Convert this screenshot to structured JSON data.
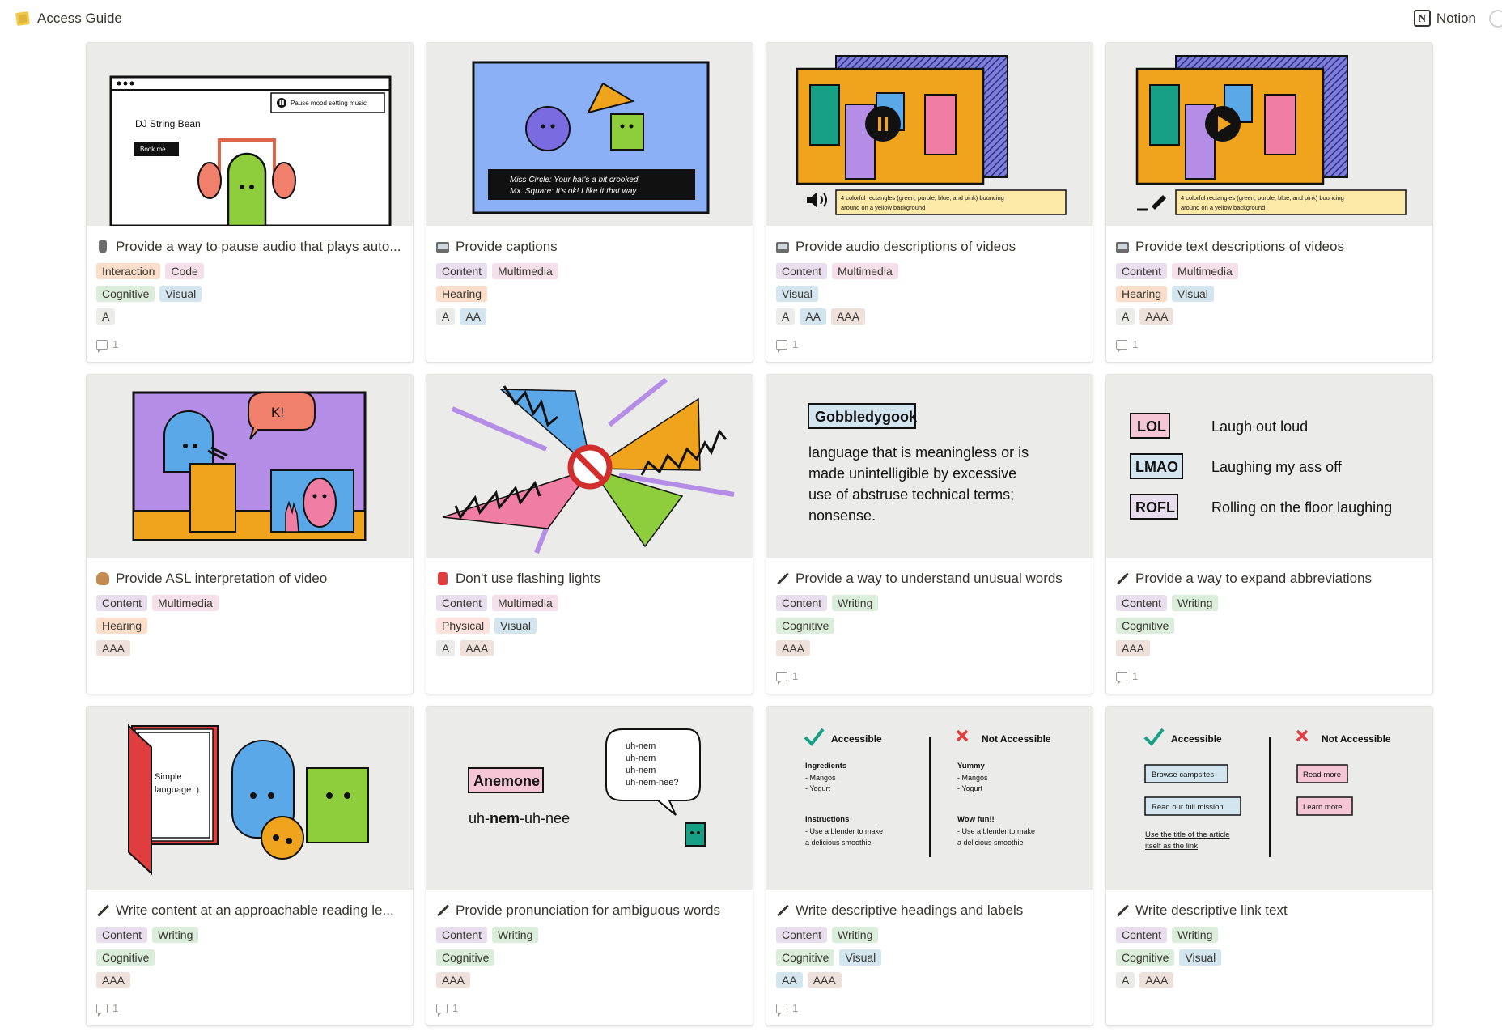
{
  "header": {
    "title": "Access Guide",
    "notion_label": "Notion"
  },
  "cards": [
    {
      "title": "Provide a way to pause audio that plays auto...",
      "icon": "microphone-icon",
      "tags": [
        [
          "Interaction",
          "Code"
        ],
        [
          "Cognitive",
          "Visual"
        ],
        [
          "A"
        ]
      ],
      "comments": "1",
      "illustration": {
        "pause_label": "Pause mood setting music",
        "site_name": "DJ String Bean",
        "book_button": "Book me"
      }
    },
    {
      "title": "Provide captions",
      "icon": "tv-icon",
      "tags": [
        [
          "Content",
          "Multimedia"
        ],
        [
          "Hearing"
        ],
        [
          "A",
          "AA"
        ]
      ],
      "comments": "",
      "illustration": {
        "caption_line1": "Miss Circle: Your hat's a bit crooked.",
        "caption_line2": "Mx. Square: It's ok! I like it that way."
      }
    },
    {
      "title": "Provide audio descriptions of videos",
      "icon": "tv-icon",
      "tags": [
        [
          "Content",
          "Multimedia"
        ],
        [
          "Visual"
        ],
        [
          "A",
          "AA",
          "AAA"
        ]
      ],
      "comments": "1",
      "illustration": {
        "desc_line1": "4 colorful rectangles (green, purple, blue, and pink) bouncing",
        "desc_line2": "around on a yellow background"
      }
    },
    {
      "title": "Provide text descriptions of videos",
      "icon": "tv-icon",
      "tags": [
        [
          "Content",
          "Multimedia"
        ],
        [
          "Hearing",
          "Visual"
        ],
        [
          "A",
          "AAA"
        ]
      ],
      "comments": "1",
      "illustration": {
        "desc_line1": "4 colorful rectangles (green, purple, blue, and pink) bouncing",
        "desc_line2": "around on a yellow background"
      }
    },
    {
      "title": "Provide ASL interpretation of video",
      "icon": "hand-icon",
      "tags": [
        [
          "Content",
          "Multimedia"
        ],
        [
          "Hearing"
        ],
        [
          "AAA"
        ]
      ],
      "comments": "",
      "illustration": {
        "speech": "K!"
      }
    },
    {
      "title": "Don't use flashing lights",
      "icon": "alarm-icon",
      "tags": [
        [
          "Content",
          "Multimedia"
        ],
        [
          "Physical",
          "Visual"
        ],
        [
          "A",
          "AAA"
        ]
      ],
      "comments": "",
      "illustration": {}
    },
    {
      "title": "Provide a way to understand unusual words",
      "icon": "pencil-icon",
      "tags": [
        [
          "Content",
          "Writing"
        ],
        [
          "Cognitive"
        ],
        [
          "AAA"
        ]
      ],
      "comments": "1",
      "illustration": {
        "word": "Gobbledygook",
        "def1": "language that is meaningless or is",
        "def2": "made unintelligible by excessive",
        "def3": "use of abstruse technical terms;",
        "def4": "nonsense."
      }
    },
    {
      "title": "Provide a way to expand abbreviations",
      "icon": "pencil-icon",
      "tags": [
        [
          "Content",
          "Writing"
        ],
        [
          "Cognitive"
        ],
        [
          "AAA"
        ]
      ],
      "comments": "1",
      "illustration": {
        "abbr": [
          [
            "LOL",
            "Laugh out loud"
          ],
          [
            "LMAO",
            "Laughing my ass off"
          ],
          [
            "ROFL",
            "Rolling on the floor laughing"
          ]
        ]
      }
    },
    {
      "title": "Write content at an approachable reading le...",
      "icon": "pencil-icon",
      "tags": [
        [
          "Content",
          "Writing"
        ],
        [
          "Cognitive"
        ],
        [
          "AAA"
        ]
      ],
      "comments": "1",
      "illustration": {
        "book1": "Simple",
        "book2": "language :)"
      }
    },
    {
      "title": "Provide pronunciation for ambiguous words",
      "icon": "pencil-icon",
      "tags": [
        [
          "Content",
          "Writing"
        ],
        [
          "Cognitive"
        ],
        [
          "AAA"
        ]
      ],
      "comments": "1",
      "illustration": {
        "word": "Anemone",
        "pron_prefix": "uh-",
        "pron_bold": "nem",
        "pron_suffix": "-uh-nee",
        "bubble": [
          "uh-nem",
          "uh-nem",
          "uh-nem",
          "uh-nem-nee?"
        ]
      }
    },
    {
      "title": "Write descriptive headings and labels",
      "icon": "pencil-icon",
      "tags": [
        [
          "Content",
          "Writing"
        ],
        [
          "Cognitive",
          "Visual"
        ],
        [
          "AA",
          "AAA"
        ]
      ],
      "comments": "1",
      "illustration": {
        "good": "Accessible",
        "bad": "Not Accessible",
        "h1": "Ingredients",
        "h1a": "- Mangos",
        "h1b": "- Yogurt",
        "h2": "Instructions",
        "h2a": "- Use a blender to make",
        "h2b": "a delicious smoothie",
        "b1": "Yummy",
        "b1a": "- Mangos",
        "b1b": "- Yogurt",
        "b2": "Wow fun!!",
        "b2a": "- Use a blender to make",
        "b2b": "a delicious smoothie"
      }
    },
    {
      "title": "Write descriptive link text",
      "icon": "pencil-icon",
      "tags": [
        [
          "Content",
          "Writing"
        ],
        [
          "Cognitive",
          "Visual"
        ],
        [
          "A",
          "AAA"
        ]
      ],
      "comments": "",
      "illustration": {
        "good": "Accessible",
        "bad": "Not Accessible",
        "g1": "Browse campsites",
        "g2": "Read our full mission",
        "g3": "Use the title of the article",
        "g4": "itself as the link",
        "n1": "Read more",
        "n2": "Learn more"
      }
    }
  ],
  "tag_colors": {
    "Interaction": "tag-orange",
    "Code": "tag-pink",
    "Cognitive": "tag-green",
    "Visual": "tag-blue",
    "Content": "tag-purple",
    "Multimedia": "tag-pink",
    "Hearing": "tag-orange",
    "Physical": "tag-red",
    "Writing": "tag-green",
    "A": "tag-gray",
    "AA": "tag-blue",
    "AAA": "tag-brown"
  }
}
